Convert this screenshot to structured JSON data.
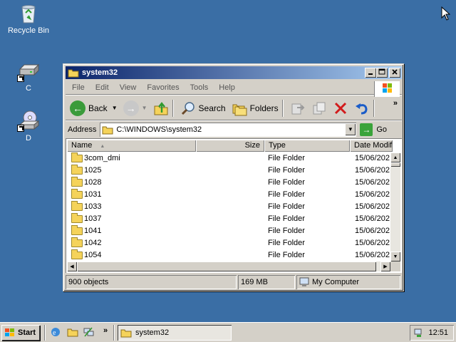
{
  "desktop": {
    "icons": [
      {
        "label": "Recycle Bin"
      },
      {
        "label": "C"
      },
      {
        "label": "D"
      }
    ]
  },
  "window": {
    "title": "system32",
    "menu": [
      "File",
      "Edit",
      "View",
      "Favorites",
      "Tools",
      "Help"
    ],
    "toolbar": {
      "back_label": "Back",
      "search_label": "Search",
      "folders_label": "Folders",
      "more_label": "»"
    },
    "address": {
      "label": "Address",
      "value": "C:\\WINDOWS\\system32",
      "go_label": "Go"
    },
    "columns": {
      "name": "Name",
      "size": "Size",
      "type": "Type",
      "date": "Date Modifi"
    },
    "rows": [
      {
        "name": "3com_dmi",
        "type": "File Folder",
        "date": "15/06/202"
      },
      {
        "name": "1025",
        "type": "File Folder",
        "date": "15/06/202"
      },
      {
        "name": "1028",
        "type": "File Folder",
        "date": "15/06/202"
      },
      {
        "name": "1031",
        "type": "File Folder",
        "date": "15/06/202"
      },
      {
        "name": "1033",
        "type": "File Folder",
        "date": "15/06/202"
      },
      {
        "name": "1037",
        "type": "File Folder",
        "date": "15/06/202"
      },
      {
        "name": "1041",
        "type": "File Folder",
        "date": "15/06/202"
      },
      {
        "name": "1042",
        "type": "File Folder",
        "date": "15/06/202"
      },
      {
        "name": "1054",
        "type": "File Folder",
        "date": "15/06/202"
      }
    ],
    "status": {
      "objects": "900 objects",
      "size": "169 MB",
      "location": "My Computer"
    }
  },
  "taskbar": {
    "start_label": "Start",
    "quicklaunch_more": "»",
    "task_label": "system32",
    "clock": "12:51"
  },
  "colors": {
    "desktop": "#3a6ea5",
    "titlebar_start": "#0a246a",
    "titlebar_end": "#a6caf0",
    "chrome": "#d4d0c8"
  }
}
